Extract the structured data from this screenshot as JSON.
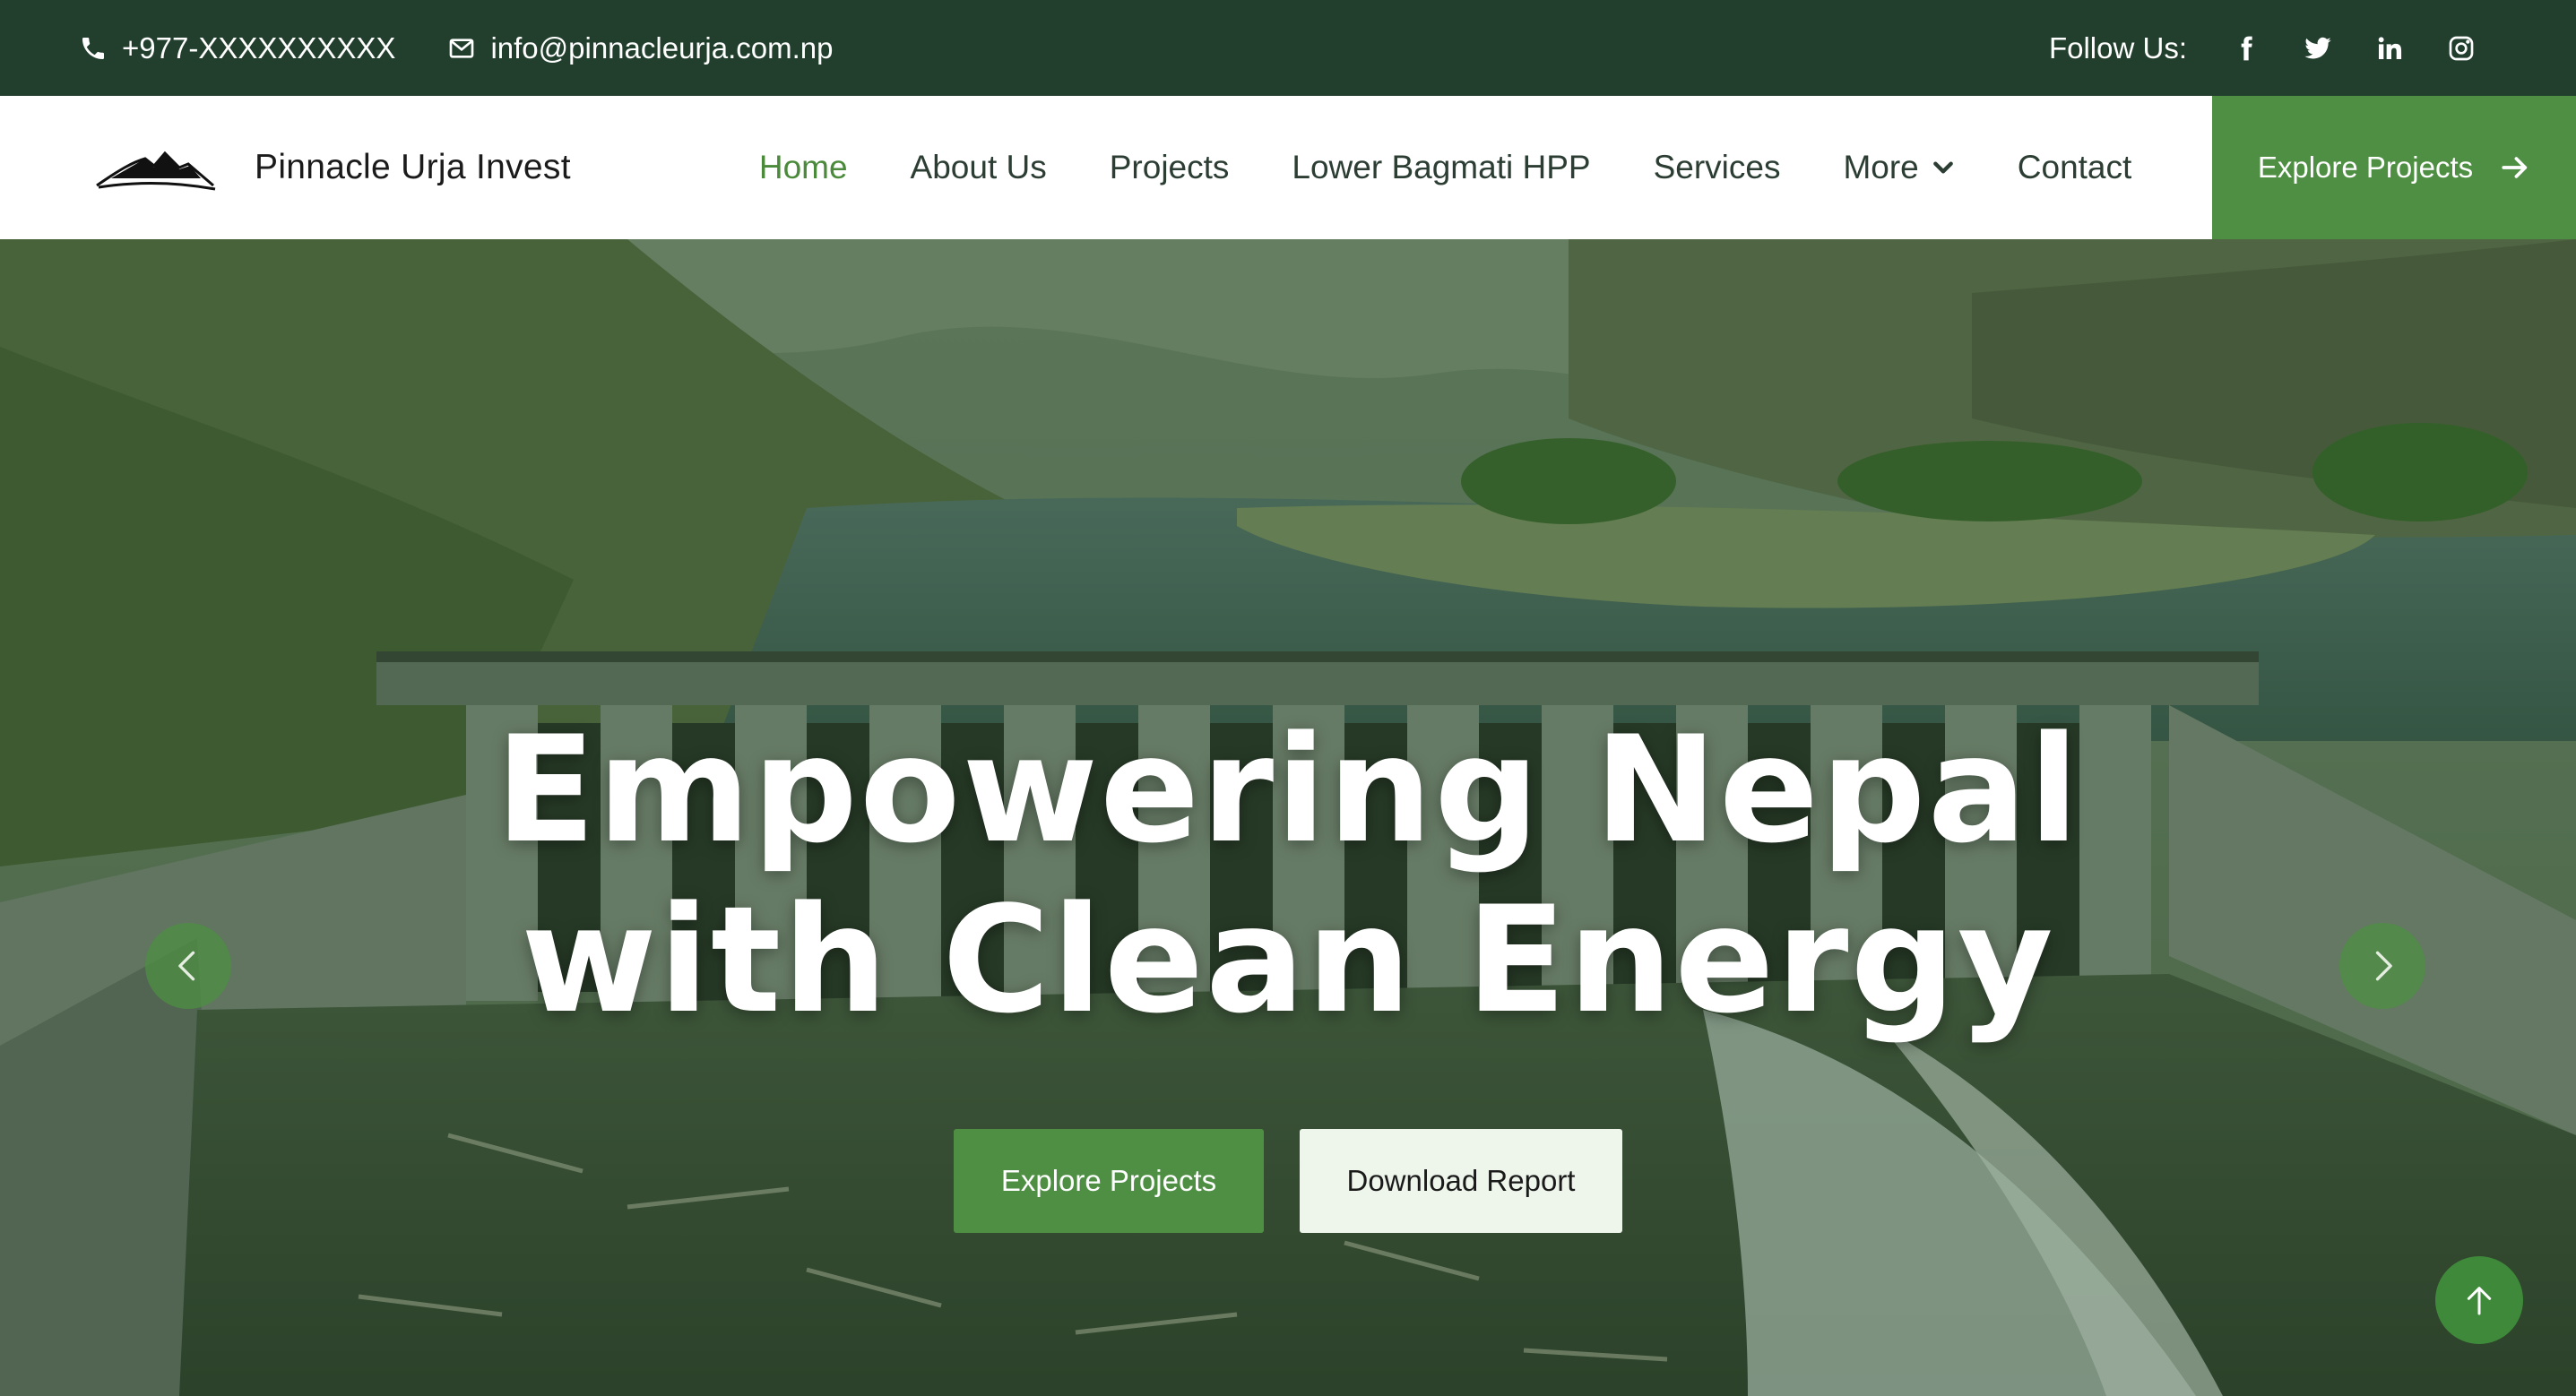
{
  "topbar": {
    "phone": "+977-XXXXXXXXXX",
    "email": "info@pinnacleurja.com.np",
    "follow_label": "Follow Us:",
    "socials": [
      "facebook-icon",
      "twitter-icon",
      "linkedin-icon",
      "instagram-icon"
    ]
  },
  "brand": {
    "name": "Pinnacle Urja Invest",
    "logo": "mountain-logo"
  },
  "nav": {
    "items": [
      {
        "label": "Home",
        "active": true
      },
      {
        "label": "About Us"
      },
      {
        "label": "Projects"
      },
      {
        "label": "Lower Bagmati HPP"
      },
      {
        "label": "Services"
      },
      {
        "label": "More",
        "dropdown": true
      },
      {
        "label": "Contact"
      }
    ],
    "cta_label": "Explore Projects"
  },
  "hero": {
    "headline_line1": "Empowering Nepal",
    "headline_line2": "with Clean Energy",
    "primary_button": "Explore Projects",
    "secondary_button": "Download Report"
  },
  "colors": {
    "topbar_bg": "#223f2e",
    "accent_green": "#4e8f43",
    "active_nav": "#4a8a3a",
    "secondary_btn_bg": "#eef6ec"
  }
}
